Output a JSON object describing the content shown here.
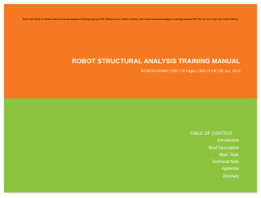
{
  "cover": {
    "notice": "Save this Book to Read robot structural analysis training manual PDF eBook at our Online Library. Get robot structural analysis training manual PDF file for free from our online library",
    "title": "ROBOT STRUCTURAL ANALYSIS TRAINING MANUAL",
    "meta": "GCWOOJHVAM | PDF | 75 Pages | 369.75 KB | 26 Jun, 2014",
    "colors": {
      "top_band": "#f47920",
      "bottom_band": "#8cc33f"
    }
  },
  "toc": {
    "heading": "TABLE OF CONTENT",
    "items": [
      "Introduction",
      "Brief Description",
      "Main Topic",
      "Technical Note",
      "Appendix",
      "Glossary"
    ]
  }
}
